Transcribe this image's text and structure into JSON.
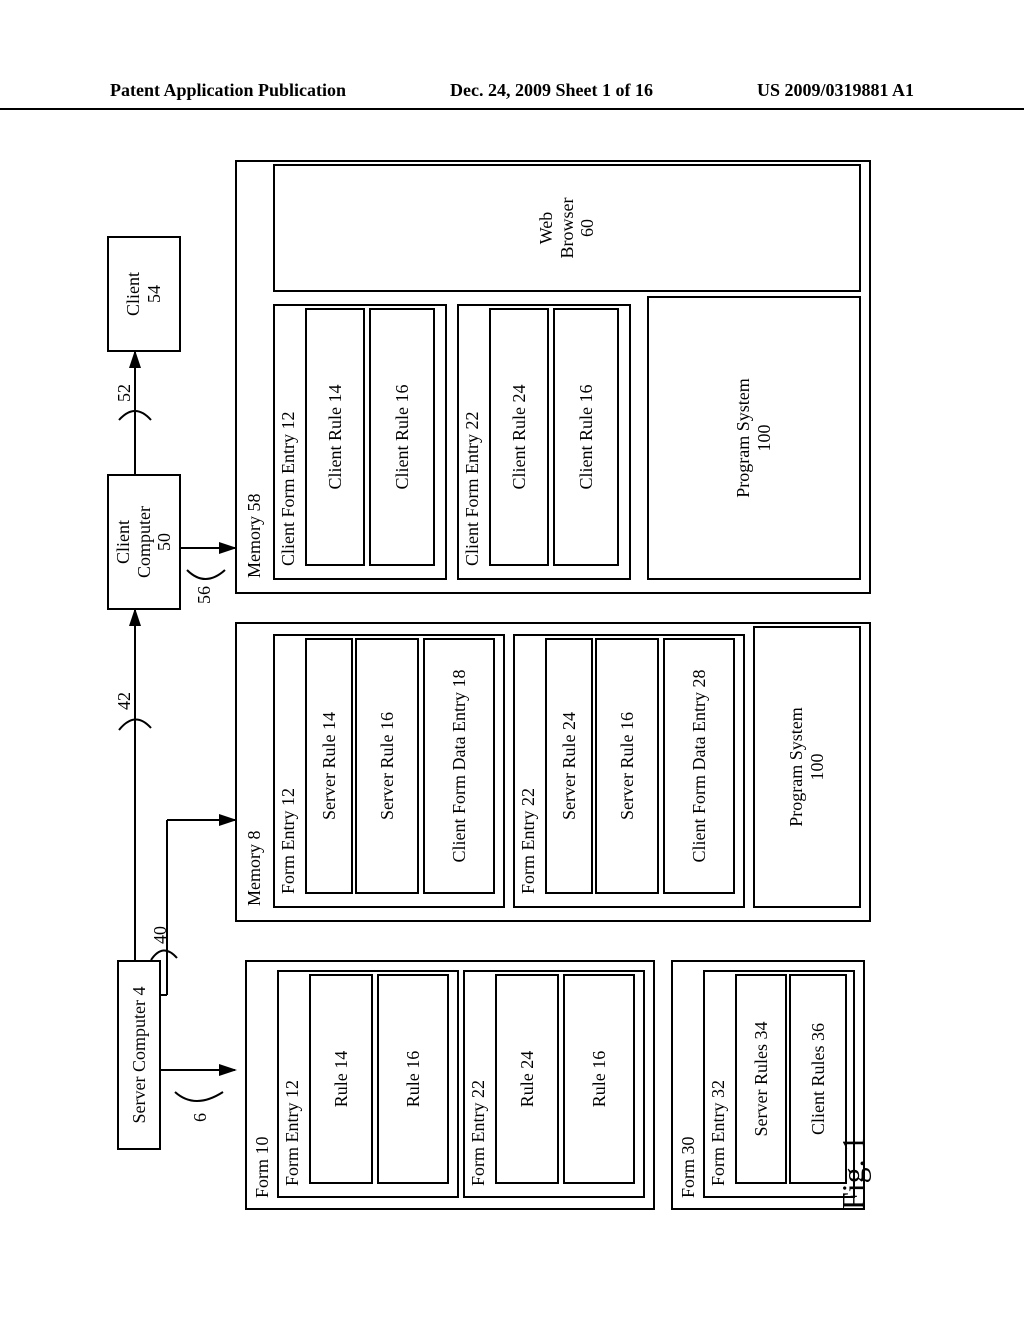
{
  "header": {
    "left": "Patent Application Publication",
    "mid": "Dec. 24, 2009  Sheet 1 of 16",
    "right": "US 2009/0319881 A1"
  },
  "top": {
    "server_computer": "Server Computer 4",
    "client_computer": "Client\nComputer\n50",
    "client": "Client\n54"
  },
  "refs": {
    "six": "6",
    "forty": "40",
    "fortytwo": "42",
    "fiftytwo": "52",
    "fiftysix": "56"
  },
  "col1": {
    "form10": "Form 10",
    "form_entry_12": "Form Entry 12",
    "rule14": "Rule 14",
    "rule16_a": "Rule 16",
    "form_entry_22": "Form Entry 22",
    "rule24": "Rule 24",
    "rule16_b": "Rule 16",
    "form30": "Form 30",
    "form_entry_32": "Form Entry 32",
    "server_rules_34": "Server Rules 34",
    "client_rules_36": "Client Rules 36"
  },
  "col2": {
    "memory8": "Memory 8",
    "form_entry_12": "Form Entry 12",
    "server_rule_14": "Server Rule 14",
    "server_rule_16_a": "Server Rule 16",
    "cfde18": "Client Form Data Entry 18",
    "form_entry_22": "Form Entry 22",
    "server_rule_24": "Server Rule 24",
    "server_rule_16_b": "Server Rule 16",
    "cfde28": "Client Form Data Entry 28",
    "prog100": "Program System\n100"
  },
  "col3": {
    "memory58": "Memory 58",
    "cfe12": "Client Form Entry 12",
    "cr14": "Client Rule 14",
    "cr16_a": "Client Rule 16",
    "cfe22": "Client Form Entry 22",
    "cr24": "Client Rule 24",
    "cr16_b": "Client Rule 16",
    "prog100": "Program System\n100",
    "web": "Web\nBrowser\n60"
  },
  "fig": "Fig. 1"
}
